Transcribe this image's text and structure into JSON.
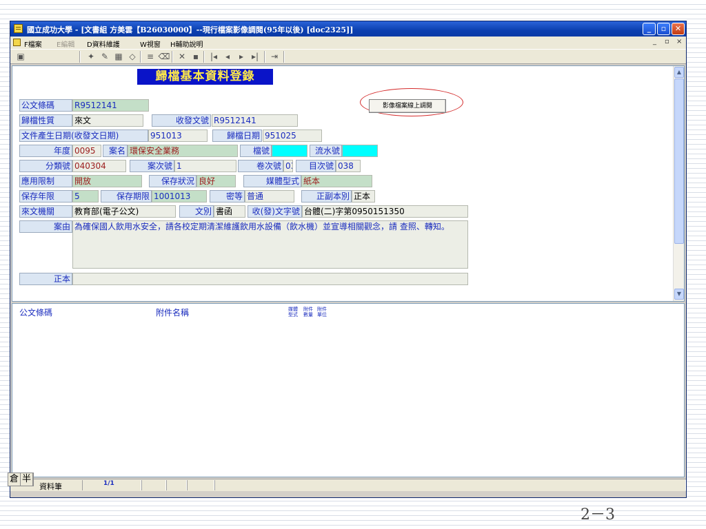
{
  "window": {
    "title": "國立成功大學 - [文書組 方美雲【B26030000】--現行檔案影像調閱(95年以後) [doc2325]]",
    "minimize_glyph": "_",
    "maximize_glyph": "▫",
    "close_glyph": "✕"
  },
  "menu": {
    "items": [
      "F檔案",
      "E編輯",
      "D資料維護",
      "W視窗",
      "H輔助說明"
    ],
    "mdi_controls": [
      "_",
      "▫",
      "×"
    ]
  },
  "toolbar": {
    "icons": [
      "image-icon",
      "wand-icon",
      "edit-icon",
      "grid-icon",
      "eraser-icon",
      "sort-icon",
      "clear-icon",
      "delete-icon",
      "save-icon",
      "first-icon",
      "prev-icon",
      "next-icon",
      "last-icon",
      "exit-icon"
    ],
    "glyphs": {
      "image": "▣",
      "wand": "✦",
      "edit": "✎",
      "grid": "▦",
      "eraser": "◇",
      "sort": "≡",
      "clear": "⌫",
      "delete": "✕",
      "save": "▪",
      "first": "|◂",
      "prev": "◂",
      "next": "▸",
      "last": "▸|",
      "exit": "⇥"
    }
  },
  "form": {
    "heading": "歸檔基本資料登錄",
    "doc_barcode": {
      "label": "公文條碼",
      "value": "R9512141"
    },
    "archive_nature": {
      "label": "歸檔性質",
      "value": "來文"
    },
    "send_receive_no": {
      "label": "收發文號",
      "value": "R9512141"
    },
    "doc_created_date": {
      "label": "文件產生日期(收發文日期)",
      "value": "951013"
    },
    "archive_date": {
      "label": "歸檔日期",
      "value": "951025"
    },
    "year": {
      "label": "年度",
      "value": "0095"
    },
    "case_name": {
      "label": "案名",
      "value": "環保安全業務"
    },
    "file_no": {
      "label": "檔號",
      "value": ""
    },
    "serial_no": {
      "label": "流水號",
      "value": ""
    },
    "category_no": {
      "label": "分類號",
      "value": "040304"
    },
    "case_sub_no": {
      "label": "案次號",
      "value": "1"
    },
    "volume_no": {
      "label": "卷次號",
      "value": "03"
    },
    "item_no": {
      "label": "目次號",
      "value": "038"
    },
    "access_limit": {
      "label": "應用限制",
      "value": "開放"
    },
    "preservation_status": {
      "label": "保存狀況",
      "value": "良好"
    },
    "media_type": {
      "label": "媒體型式",
      "value": "紙本"
    },
    "retention_years": {
      "label": "保存年限",
      "value": "5"
    },
    "retention_deadline": {
      "label": "保存期限",
      "value": "1001013"
    },
    "classification": {
      "label": "密等",
      "value": "普通"
    },
    "copy_type": {
      "label": "正副本別",
      "value": "正本"
    },
    "sender_agency": {
      "label": "來文機關",
      "value": "教育部(電子公文)"
    },
    "doc_type": {
      "label": "文別",
      "value": "書函"
    },
    "send_receive_word_no": {
      "label": "收(發)文字號",
      "value": "台體(二)字第0950151350"
    },
    "subject": {
      "label": "案由",
      "value": "為確保國人飲用水安全，請各校定期清潔維護飲用水設備（飲水機）並宣導相關觀念，請  查照、轉知。"
    },
    "original": {
      "label": "正本",
      "value": ""
    },
    "image_view_button": "影像檔案線上調閱"
  },
  "grid": {
    "columns": [
      "公文條碼",
      "附件名稱",
      "媒體型式",
      "附件數量",
      "附件單位"
    ]
  },
  "statusbar": {
    "label": "資料筆",
    "record": "1/1"
  },
  "ime": {
    "mode1": "倉",
    "mode2": "半"
  },
  "slide_number": "2－3"
}
